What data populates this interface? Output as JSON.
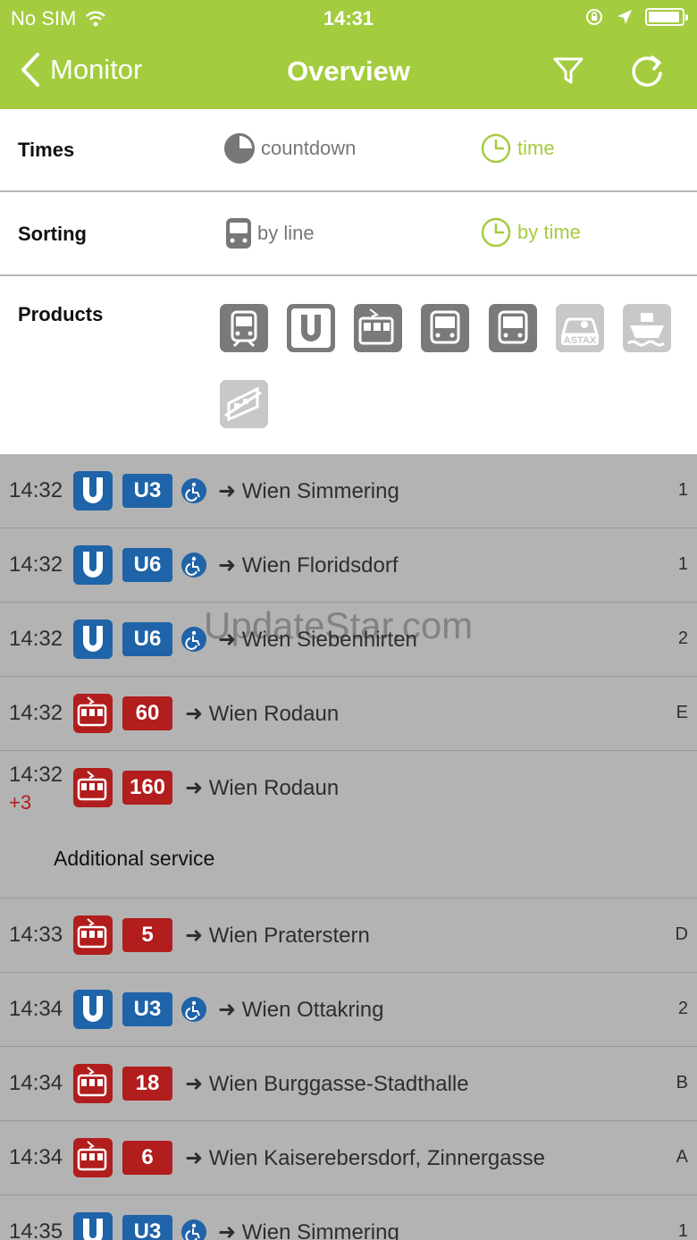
{
  "status_bar": {
    "carrier": "No SIM",
    "time": "14:31"
  },
  "nav": {
    "back_label": "Monitor",
    "title": "Overview"
  },
  "settings": {
    "times": {
      "label": "Times",
      "options": [
        "countdown",
        "time"
      ],
      "selected": "time"
    },
    "sorting": {
      "label": "Sorting",
      "options": [
        "by line",
        "by time"
      ],
      "selected": "by time"
    },
    "products": {
      "label": "Products",
      "items": [
        {
          "name": "train",
          "active": true
        },
        {
          "name": "u-bahn",
          "active": true
        },
        {
          "name": "tram",
          "active": true
        },
        {
          "name": "bus",
          "active": true
        },
        {
          "name": "regional-bus",
          "active": true
        },
        {
          "name": "astax",
          "label": "ASTAX",
          "active": false
        },
        {
          "name": "ferry",
          "active": false
        },
        {
          "name": "cable-car",
          "active": false
        }
      ]
    }
  },
  "departures": [
    {
      "time": "14:32",
      "mode": "ubahn",
      "line": "U3",
      "accessible": true,
      "dest": "Wien Simmering",
      "platform": "1"
    },
    {
      "time": "14:32",
      "mode": "ubahn",
      "line": "U6",
      "accessible": true,
      "dest": "Wien Floridsdorf",
      "platform": "1"
    },
    {
      "time": "14:32",
      "mode": "ubahn",
      "line": "U6",
      "accessible": true,
      "dest": "Wien Siebenhirten",
      "platform": "2"
    },
    {
      "time": "14:32",
      "mode": "tram",
      "line": "60",
      "accessible": false,
      "dest": "Wien Rodaun",
      "platform": "E"
    },
    {
      "time": "14:32",
      "delay": "+3",
      "mode": "tram",
      "line": "160",
      "accessible": false,
      "dest": "Wien Rodaun",
      "platform": "",
      "note": "Additional service"
    },
    {
      "time": "14:33",
      "mode": "tram",
      "line": "5",
      "accessible": false,
      "dest": "Wien Praterstern",
      "platform": "D"
    },
    {
      "time": "14:34",
      "mode": "ubahn",
      "line": "U3",
      "accessible": true,
      "dest": "Wien Ottakring",
      "platform": "2"
    },
    {
      "time": "14:34",
      "mode": "tram",
      "line": "18",
      "accessible": false,
      "dest": "Wien Burggasse-Stadthalle",
      "platform": "B"
    },
    {
      "time": "14:34",
      "mode": "tram",
      "line": "6",
      "accessible": false,
      "dest": "Wien Kaiserebersdorf, Zinnergasse",
      "platform": "A"
    },
    {
      "time": "14:35",
      "mode": "ubahn",
      "line": "U3",
      "accessible": true,
      "dest": "Wien Simmering",
      "platform": "1"
    }
  ],
  "watermark": "UpdateStar.com",
  "colors": {
    "accent": "#a3cc3f",
    "ubahn": "#1f63a8",
    "tram": "#b21d1d",
    "overlay": "#b3b3b3"
  }
}
